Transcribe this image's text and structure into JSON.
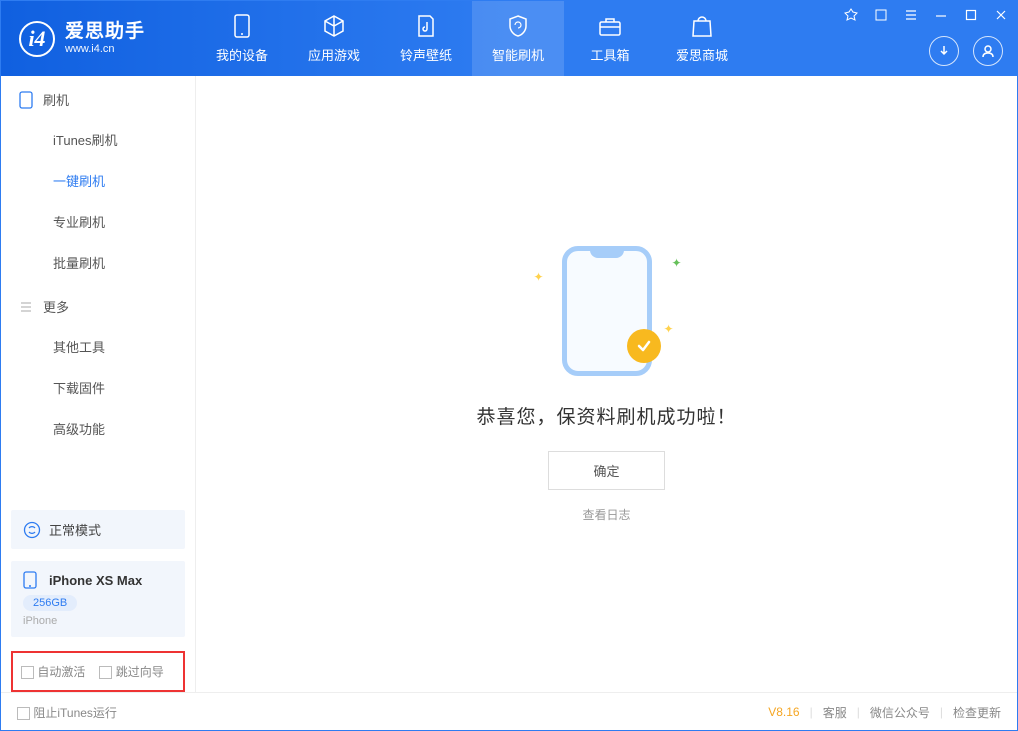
{
  "app": {
    "name_cn": "爱思助手",
    "name_en": "www.i4.cn"
  },
  "nav": {
    "items": [
      {
        "label": "我的设备"
      },
      {
        "label": "应用游戏"
      },
      {
        "label": "铃声壁纸"
      },
      {
        "label": "智能刷机"
      },
      {
        "label": "工具箱"
      },
      {
        "label": "爱思商城"
      }
    ]
  },
  "sidebar": {
    "section_flash": "刷机",
    "items_flash": [
      {
        "label": "iTunes刷机"
      },
      {
        "label": "一键刷机",
        "active": true
      },
      {
        "label": "专业刷机"
      },
      {
        "label": "批量刷机"
      }
    ],
    "section_more": "更多",
    "items_more": [
      {
        "label": "其他工具"
      },
      {
        "label": "下载固件"
      },
      {
        "label": "高级功能"
      }
    ],
    "mode": "正常模式",
    "device": {
      "name": "iPhone XS Max",
      "storage": "256GB",
      "type": "iPhone"
    },
    "opt_auto_activate": "自动激活",
    "opt_skip_guide": "跳过向导"
  },
  "main": {
    "success_msg": "恭喜您，保资料刷机成功啦！",
    "ok": "确定",
    "view_log": "查看日志"
  },
  "footer": {
    "block_itunes": "阻止iTunes运行",
    "version": "V8.16",
    "support": "客服",
    "wechat": "微信公众号",
    "update": "检查更新"
  }
}
